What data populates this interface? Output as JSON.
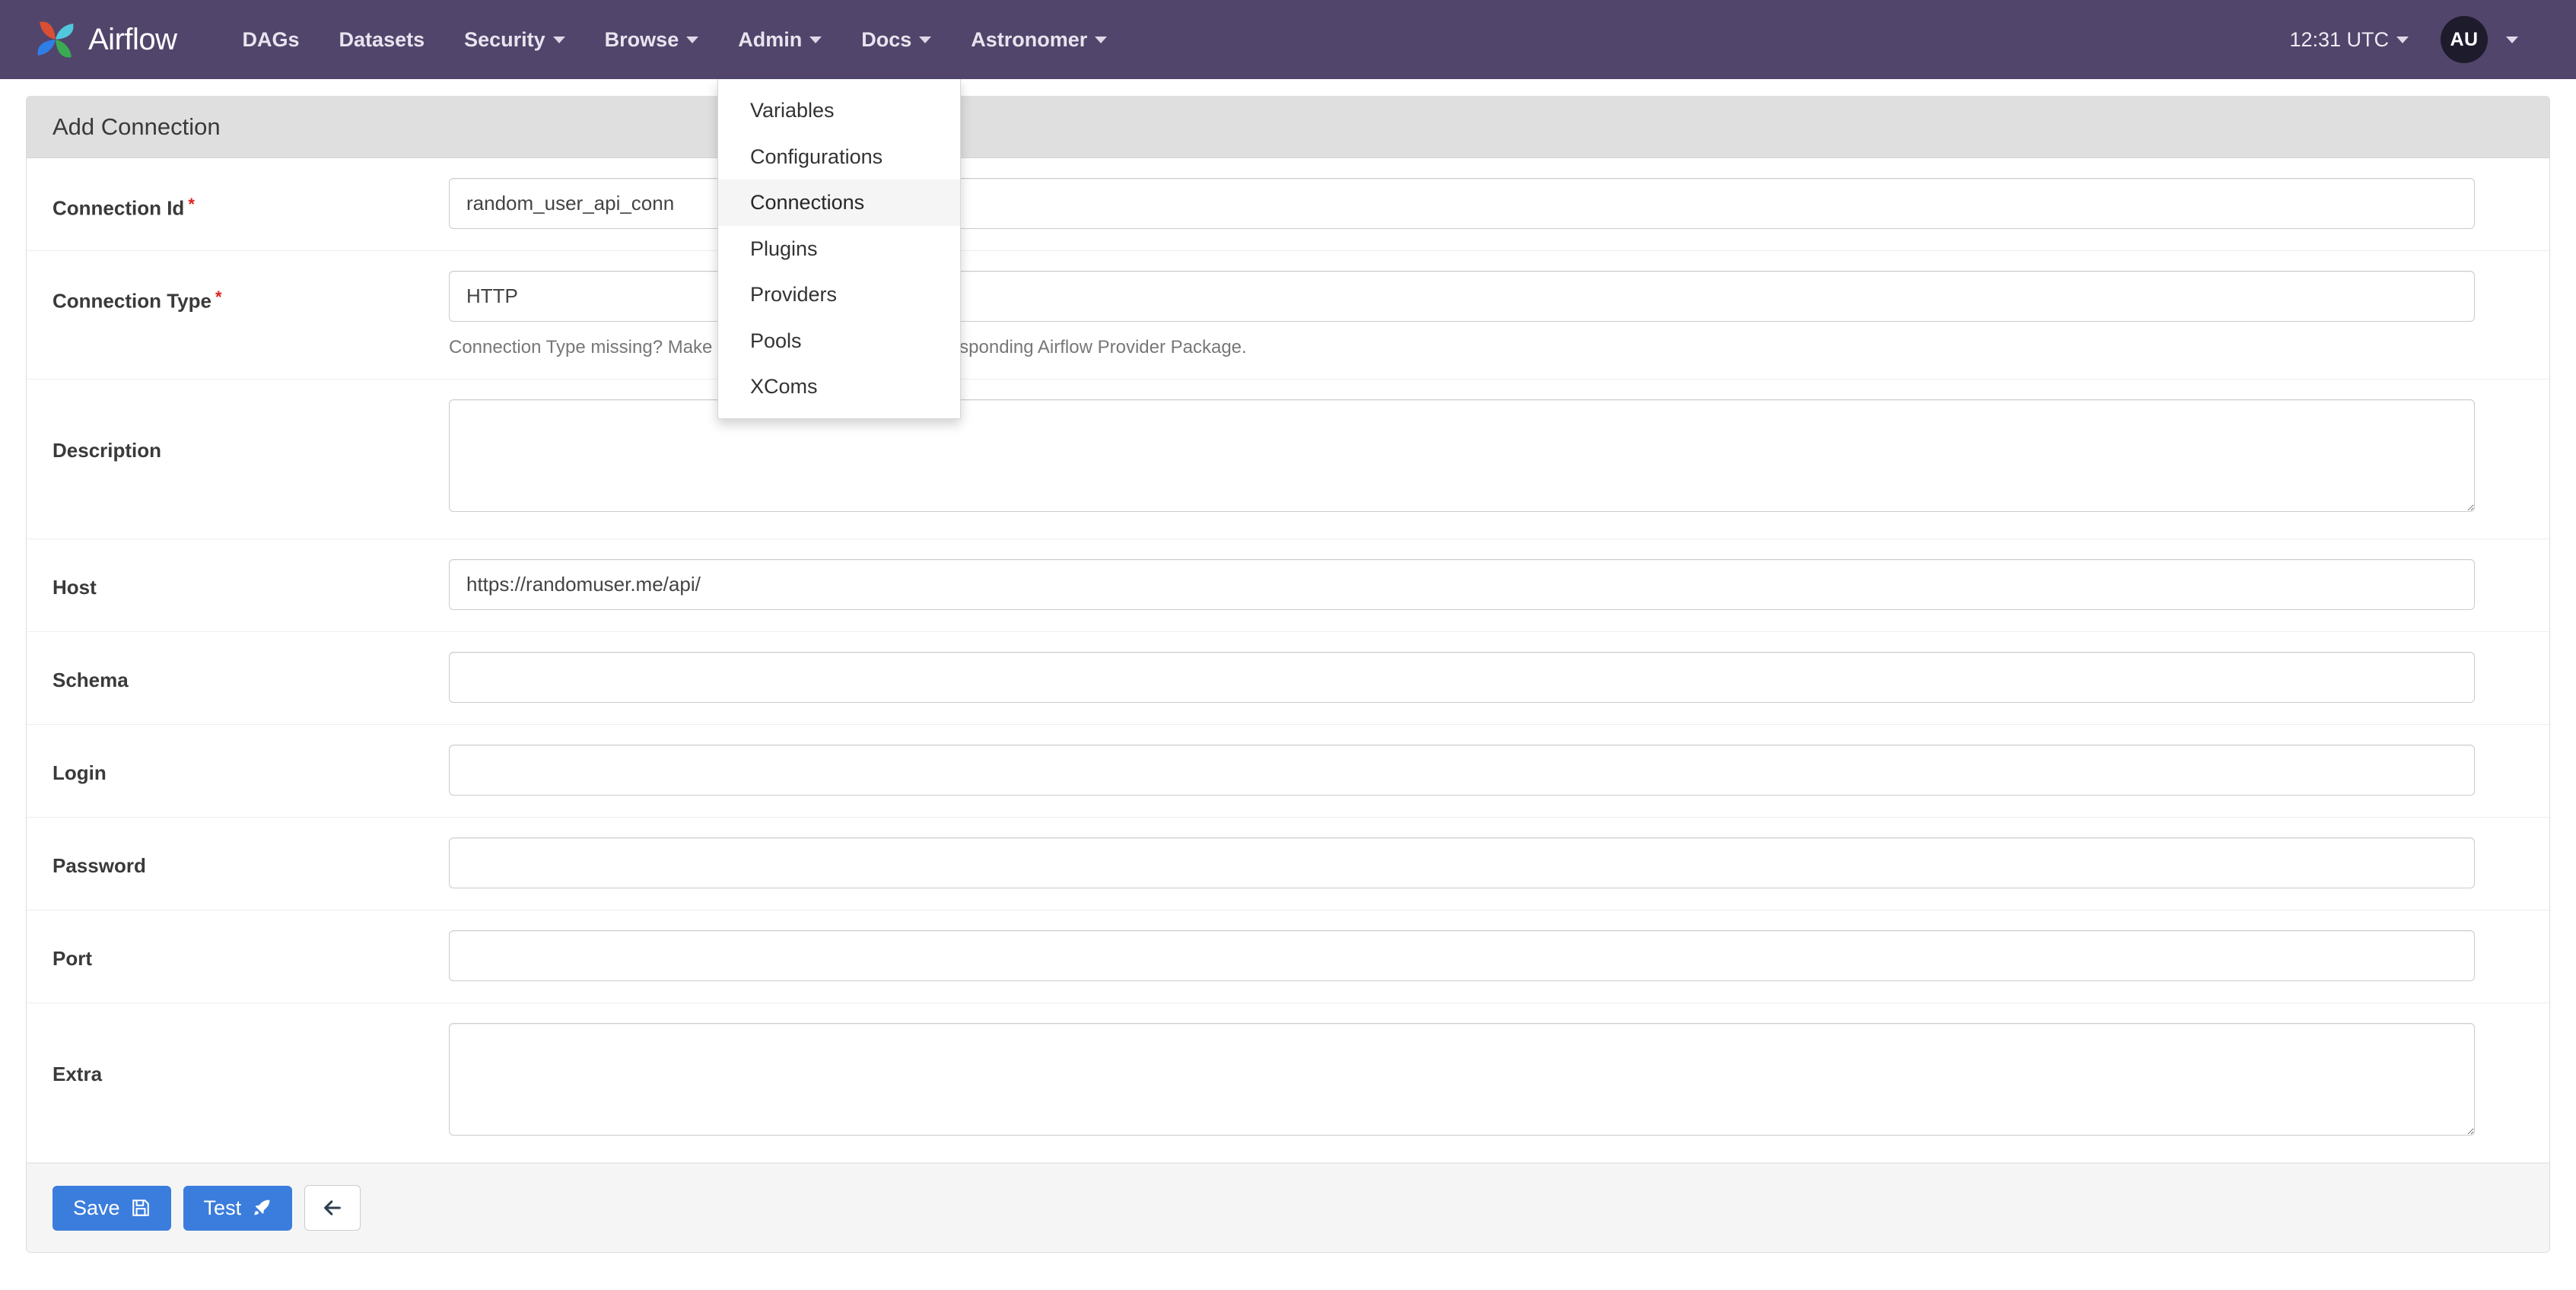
{
  "navbar": {
    "brand": "Airflow",
    "brand_logo_icon": "airflow-pinwheel-logo",
    "items": [
      {
        "label": "DAGs",
        "has_caret": false
      },
      {
        "label": "Datasets",
        "has_caret": false
      },
      {
        "label": "Security",
        "has_caret": true
      },
      {
        "label": "Browse",
        "has_caret": true
      },
      {
        "label": "Admin",
        "has_caret": true
      },
      {
        "label": "Docs",
        "has_caret": true
      },
      {
        "label": "Astronomer",
        "has_caret": true
      }
    ],
    "clock": "12:31 UTC",
    "avatar_initials": "AU",
    "background_color": "#51456b"
  },
  "admin_menu": {
    "open": true,
    "items": [
      {
        "label": "Variables",
        "active": false
      },
      {
        "label": "Configurations",
        "active": false
      },
      {
        "label": "Connections",
        "active": true
      },
      {
        "label": "Plugins",
        "active": false
      },
      {
        "label": "Providers",
        "active": false
      },
      {
        "label": "Pools",
        "active": false
      },
      {
        "label": "XComs",
        "active": false
      }
    ]
  },
  "panel": {
    "title": "Add Connection"
  },
  "form": {
    "fields": [
      {
        "label": "Connection Id",
        "required": true,
        "type": "text",
        "value": "random_user_api_conn",
        "placeholder": "",
        "hint": ""
      },
      {
        "label": "Connection Type",
        "required": true,
        "type": "select",
        "value": "HTTP",
        "placeholder": "",
        "hint": "Connection Type missing? Make sure you've installed the corresponding Airflow Provider Package."
      },
      {
        "label": "Description",
        "required": false,
        "type": "textarea",
        "value": "",
        "placeholder": "",
        "hint": ""
      },
      {
        "label": "Host",
        "required": false,
        "type": "text",
        "value": "https://randomuser.me/api/",
        "placeholder": "",
        "hint": ""
      },
      {
        "label": "Schema",
        "required": false,
        "type": "text",
        "value": "",
        "placeholder": "",
        "hint": ""
      },
      {
        "label": "Login",
        "required": false,
        "type": "text",
        "value": "",
        "placeholder": "",
        "hint": ""
      },
      {
        "label": "Password",
        "required": false,
        "type": "password",
        "value": "",
        "placeholder": "",
        "hint": ""
      },
      {
        "label": "Port",
        "required": false,
        "type": "text",
        "value": "",
        "placeholder": "",
        "hint": ""
      },
      {
        "label": "Extra",
        "required": false,
        "type": "textarea",
        "value": "",
        "placeholder": "",
        "hint": ""
      }
    ],
    "required_marker": "*"
  },
  "footer": {
    "save_label": "Save",
    "save_icon": "floppy-disk-icon",
    "test_label": "Test",
    "test_icon": "rocket-icon",
    "back_icon": "arrow-left-icon",
    "primary_color": "#3b7ddd"
  }
}
